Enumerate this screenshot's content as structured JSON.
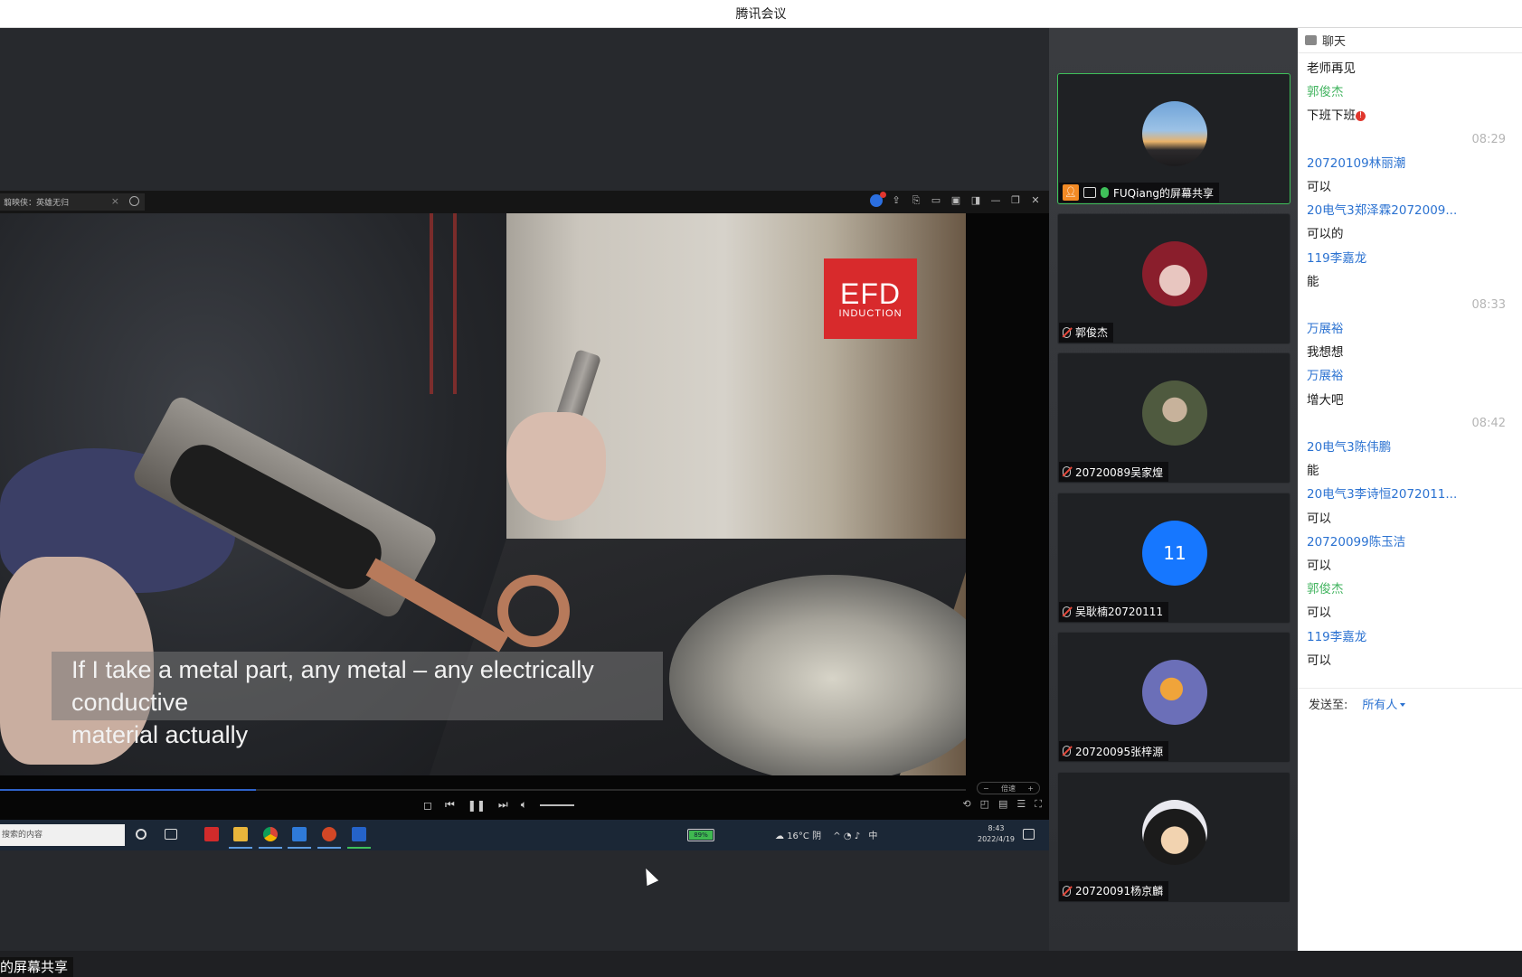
{
  "window": {
    "title": "腾讯会议"
  },
  "player": {
    "tab_label": "翦映侠：英雄无归",
    "tab_close": "×",
    "subtitle_line1": "If I take a metal part, any metal – any electrically conductive",
    "subtitle_line2": "material actually",
    "logo_main": "EFD",
    "logo_sub": "INDUCTION",
    "speed_minus": "−",
    "speed_label": "倍速",
    "speed_plus": "+",
    "progress_fraction": 0.265
  },
  "taskbar": {
    "search_placeholder": "搜索的内容",
    "battery": "89%",
    "weather": "16°C 阴",
    "ime": "中",
    "time": "8:43",
    "date": "2022/4/19"
  },
  "share_label": "的屏幕共享",
  "participants": [
    {
      "name": "FUQiang的屏幕共享",
      "active": true,
      "avatar": "sunset"
    },
    {
      "name": "郭俊杰",
      "active": false,
      "avatar": "anime-girl"
    },
    {
      "name": "20720089吴家煌",
      "active": false,
      "avatar": "soldier"
    },
    {
      "name": "吴耿楠20720111",
      "active": false,
      "avatar": "number",
      "avatar_text": "11"
    },
    {
      "name": "20720095张梓源",
      "active": false,
      "avatar": "banana-moon"
    },
    {
      "name": "20720091杨京麟",
      "active": false,
      "avatar": "goku"
    }
  ],
  "chat": {
    "title": "聊天",
    "messages": [
      {
        "kind": "text",
        "text": "老师再见"
      },
      {
        "kind": "sender",
        "color": "green",
        "text": "郭俊杰"
      },
      {
        "kind": "text",
        "text": "下班下班",
        "alert": "!"
      },
      {
        "kind": "time",
        "text": "08:29"
      },
      {
        "kind": "sender",
        "text": "20720109林丽潮"
      },
      {
        "kind": "text",
        "text": "可以"
      },
      {
        "kind": "sender",
        "text": "20电气3郑泽霖2072009..."
      },
      {
        "kind": "text",
        "text": "可以的"
      },
      {
        "kind": "sender",
        "text": "119李嘉龙"
      },
      {
        "kind": "text",
        "text": "能"
      },
      {
        "kind": "time",
        "text": "08:33"
      },
      {
        "kind": "sender",
        "text": "万展裕"
      },
      {
        "kind": "text",
        "text": "我想想"
      },
      {
        "kind": "sender",
        "text": "万展裕"
      },
      {
        "kind": "text",
        "text": "增大吧"
      },
      {
        "kind": "time",
        "text": "08:42"
      },
      {
        "kind": "sender",
        "text": "20电气3陈伟鹏"
      },
      {
        "kind": "text",
        "text": "能"
      },
      {
        "kind": "sender",
        "text": "20电气3李诗恒2072011..."
      },
      {
        "kind": "text",
        "text": "可以"
      },
      {
        "kind": "sender",
        "text": "20720099陈玉洁"
      },
      {
        "kind": "text",
        "text": "可以"
      },
      {
        "kind": "sender",
        "color": "green",
        "text": "郭俊杰"
      },
      {
        "kind": "text",
        "text": "可以"
      },
      {
        "kind": "sender",
        "text": "119李嘉龙"
      },
      {
        "kind": "text",
        "text": "可以"
      }
    ],
    "send_to_label": "发送至:",
    "send_to_target": "所有人"
  }
}
